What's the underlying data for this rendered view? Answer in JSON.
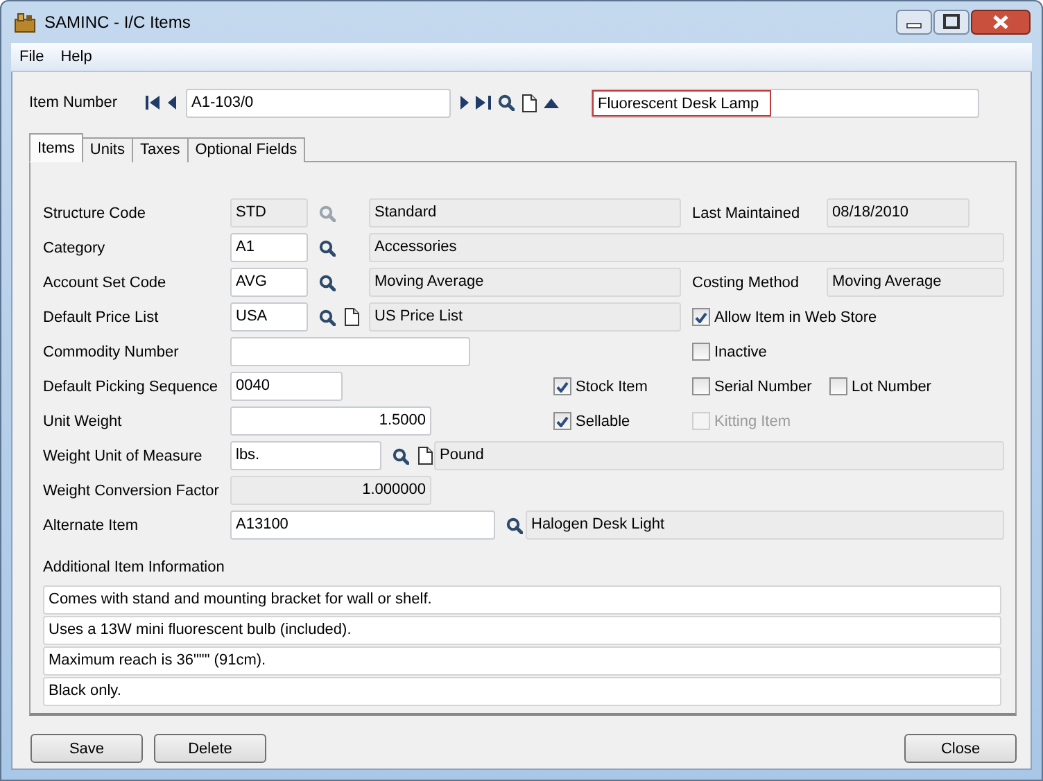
{
  "window": {
    "title": "SAMINC - I/C Items"
  },
  "menu": [
    "File",
    "Help"
  ],
  "item_number": {
    "label": "Item Number",
    "value": "A1-103/0",
    "description": "Fluorescent Desk Lamp",
    "description_highlighted": true
  },
  "tabs": [
    {
      "label": "Items",
      "selected": true
    },
    {
      "label": "Units",
      "selected": false
    },
    {
      "label": "Taxes",
      "selected": false
    },
    {
      "label": "Optional Fields",
      "selected": false
    }
  ],
  "rows": [
    {
      "label": "Structure Code",
      "value": "STD",
      "readonly": true,
      "finder": true,
      "finder_disabled": true,
      "description": "Standard",
      "right": [
        {
          "kind": "labeled",
          "label": "Last Maintained",
          "value": "08/18/2010"
        }
      ]
    },
    {
      "label": "Category",
      "value": "A1",
      "readonly": false,
      "finder": true,
      "finder_disabled": false,
      "description": "Accessories"
    },
    {
      "label": "Account Set Code",
      "value": "AVG",
      "readonly": false,
      "finder": true,
      "finder_disabled": false,
      "description": "Moving Average",
      "right": [
        {
          "kind": "labeled",
          "label": "Costing Method",
          "value": "Moving Average"
        }
      ]
    },
    {
      "label": "Default Price List",
      "value": "USA",
      "readonly": false,
      "finder": true,
      "finder_disabled": false,
      "new_button": true,
      "description": "US Price List",
      "right": [
        {
          "kind": "checkbox",
          "label": "Allow Item in Web Store",
          "checked": true,
          "disabled": false
        }
      ]
    },
    {
      "label": "Commodity Number",
      "value": "",
      "readonly": false,
      "right": [
        {
          "kind": "checkbox",
          "label": "Inactive",
          "checked": false,
          "disabled": false
        }
      ]
    },
    {
      "label": "Default Picking Sequence",
      "value": "0040",
      "readonly": false,
      "middle": {
        "label": "Stock Item",
        "checked": true,
        "disabled": false
      },
      "right": [
        {
          "kind": "checkbox",
          "label": "Serial Number",
          "checked": false,
          "disabled": false
        },
        {
          "kind": "checkbox",
          "label": "Lot Number",
          "checked": false,
          "disabled": false
        }
      ]
    },
    {
      "label": "Unit Weight",
      "value": "1.5000",
      "numeric": true,
      "readonly": false,
      "middle": {
        "label": "Sellable",
        "checked": true,
        "disabled": false
      },
      "right": [
        {
          "kind": "checkbox",
          "label": "Kitting Item",
          "checked": false,
          "disabled": true
        }
      ]
    },
    {
      "label": "Weight Unit of Measure",
      "value": "lbs.",
      "readonly": false,
      "finder": true,
      "finder_disabled": false,
      "new_button": true,
      "description": "Pound"
    },
    {
      "label": "Weight Conversion Factor",
      "value": "1.000000",
      "numeric": true,
      "readonly": true
    },
    {
      "label": "Alternate Item",
      "value": "A13100",
      "readonly": false,
      "finder": true,
      "finder_disabled": false,
      "description": "Halogen Desk Light"
    }
  ],
  "additional_info": {
    "label": "Additional Item Information",
    "lines": [
      "Comes with stand and mounting bracket for wall or shelf.",
      "Uses a 13W mini fluorescent bulb (included).",
      "Maximum reach is 36\"\"\" (91cm).",
      "Black only."
    ]
  },
  "buttons": {
    "left": [
      "Save",
      "Delete"
    ],
    "right": [
      "Close"
    ]
  }
}
